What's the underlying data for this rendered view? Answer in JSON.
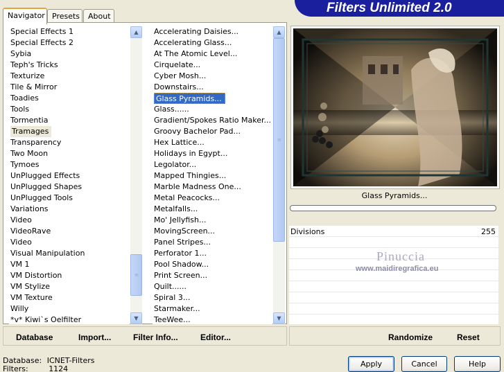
{
  "tabs": [
    "Navigator",
    "Presets",
    "About"
  ],
  "banner_title": "Filters Unlimited 2.0",
  "categories": [
    "Special Effects 1",
    "Special Effects 2",
    "Sybia",
    "Teph's Tricks",
    "Texturize",
    "Tile & Mirror",
    "Toadies",
    "Tools",
    "Tormentia",
    "Tramages",
    "Transparency",
    "Two Moon",
    "Tymoes",
    "UnPlugged Effects",
    "UnPlugged Shapes",
    "UnPlugged Tools",
    "Variations",
    "Video",
    "VideoRave",
    "Video",
    "Visual Manipulation",
    "VM 1",
    "VM Distortion",
    "VM Stylize",
    "VM Texture",
    "Willy",
    "*v* Kiwi`s Oelfilter"
  ],
  "selected_category": "Tramages",
  "filters": [
    "Accelerating Daisies...",
    "Accelerating Glass...",
    "At The Atomic Level...",
    "Cirquelate...",
    "Cyber Mosh...",
    "Downstairs...",
    "Glass Pyramids...",
    "Glass......",
    "Gradient/Spokes Ratio Maker...",
    "Groovy Bachelor Pad...",
    "Hex Lattice...",
    "Holidays in Egypt...",
    "Legolator...",
    "Mapped Thingies...",
    "Marble Madness One...",
    "Metal Peacocks...",
    "Metalfalls...",
    "Mo' Jellyfish...",
    "MovingScreen...",
    "Panel Stripes...",
    "Perforator 1...",
    "Pool Shadow...",
    "Print Screen...",
    "Quilt......",
    "Spiral 3...",
    "Starmaker...",
    "TeeWee..."
  ],
  "selected_filter": "Glass Pyramids...",
  "scroll": {
    "categories_thumb_position": 0.93,
    "filters_thumb_position": 0.0
  },
  "links": {
    "database": "Database",
    "import": "Import...",
    "filter_info": "Filter Info...",
    "editor": "Editor..."
  },
  "preview_title": "Glass Pyramids...",
  "parameters": [
    {
      "name": "Divisions",
      "value": "255"
    }
  ],
  "watermark": {
    "name": "Pinuccia",
    "url": "www.maidiregrafica.eu"
  },
  "right_links": {
    "randomize": "Randomize",
    "reset": "Reset"
  },
  "status": {
    "database_label": "Database:",
    "database_value": "ICNET-Filters",
    "filters_label": "Filters:",
    "filters_value": "1124"
  },
  "buttons": {
    "apply": "Apply",
    "cancel": "Cancel",
    "help": "Help"
  },
  "colors": {
    "banner": "#1a1f9e",
    "selection": "#316ac5",
    "tab_highlight": "#e8a33c"
  }
}
